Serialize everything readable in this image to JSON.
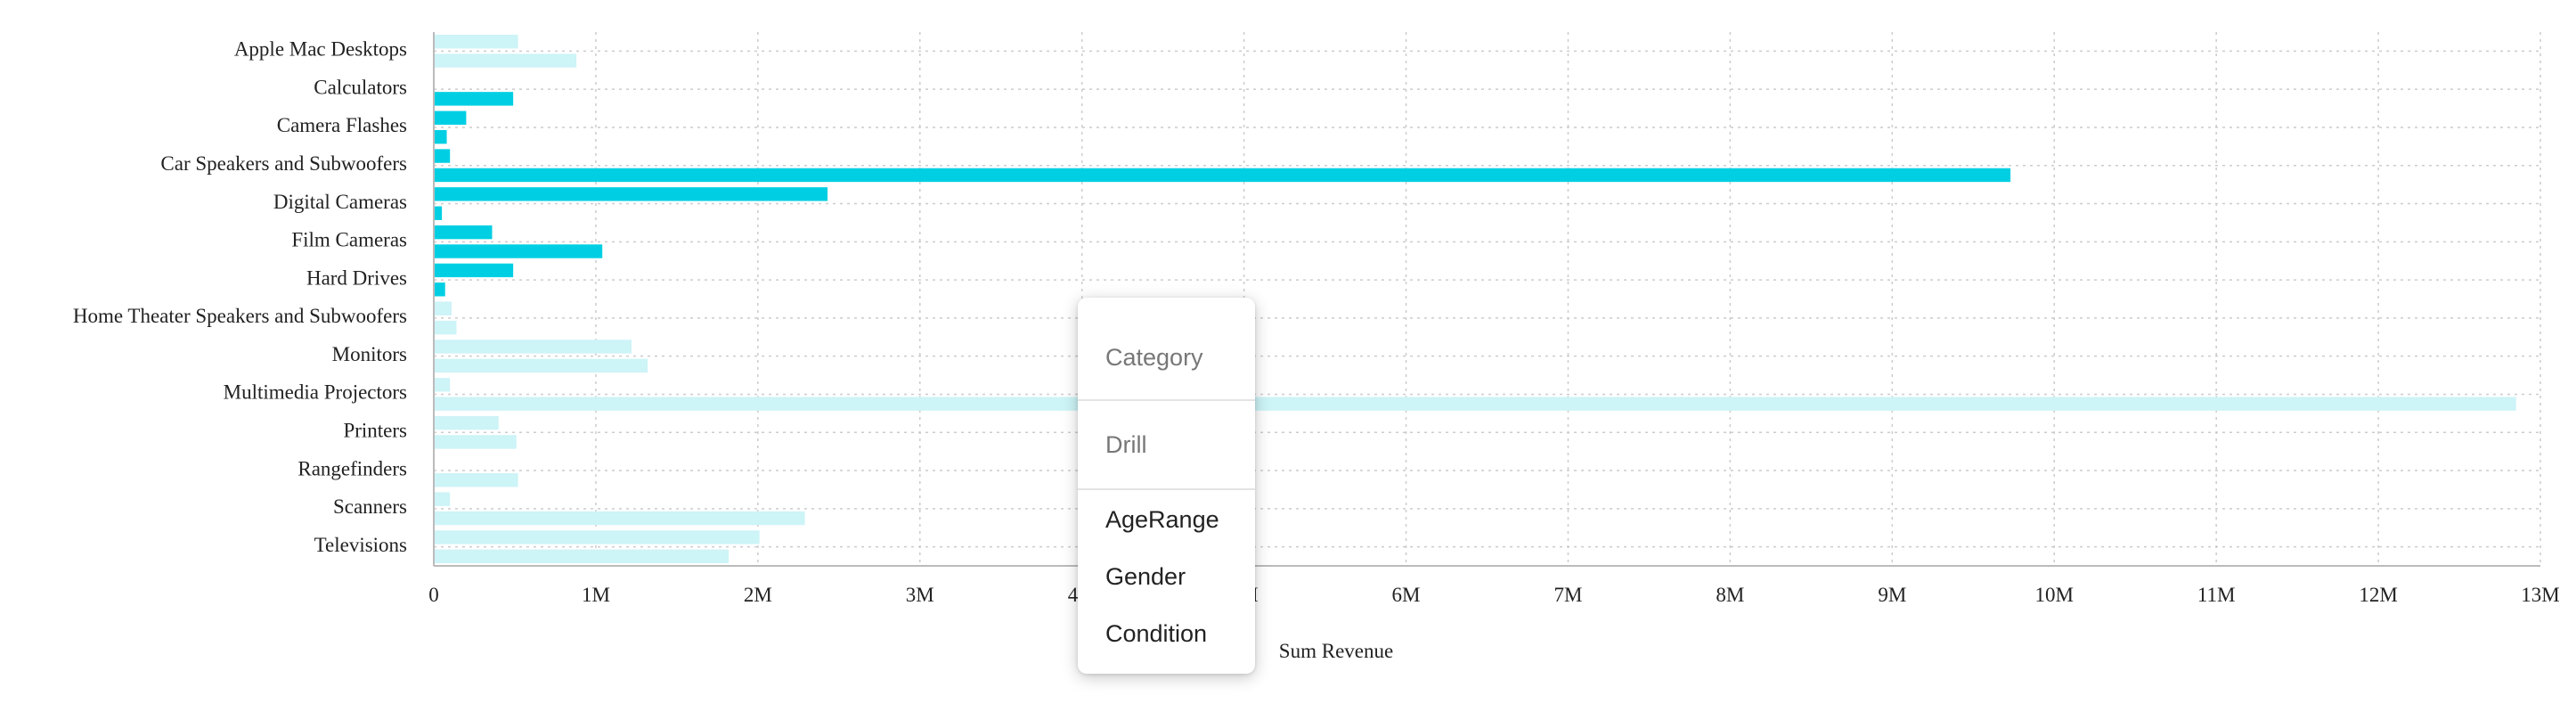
{
  "chart_data": {
    "type": "bar",
    "orientation": "horizontal",
    "title": "",
    "xlabel": "Sum Revenue",
    "ylabel": "",
    "xlim": [
      0,
      13000000
    ],
    "x_ticks": [
      "0",
      "1M",
      "2M",
      "3M",
      "4M",
      "5M",
      "6M",
      "7M",
      "8M",
      "9M",
      "10M",
      "11M",
      "12M",
      "13M"
    ],
    "grid": true,
    "legend": "none",
    "colors": {
      "highlight": "#00cfe3",
      "dim": "#cdf4f7",
      "grid": "#cccccc",
      "axis": "#bbbbbb"
    },
    "categories": [
      "Apple Mac Desktops",
      "Calculators",
      "Camera Flashes",
      "Car Speakers and Subwoofers",
      "Digital Cameras",
      "Film Cameras",
      "Hard Drives",
      "Home Theater Speakers and Subwoofers",
      "Monitors",
      "Multimedia Projectors",
      "Printers",
      "Rangefinders",
      "Scanners",
      "Televisions"
    ],
    "bars": [
      {
        "value": 520000,
        "state": "dim"
      },
      {
        "value": 880000,
        "state": "dim"
      },
      {
        "value": 0,
        "state": "highlight"
      },
      {
        "value": 490000,
        "state": "highlight"
      },
      {
        "value": 200000,
        "state": "highlight"
      },
      {
        "value": 80000,
        "state": "highlight"
      },
      {
        "value": 100000,
        "state": "highlight"
      },
      {
        "value": 9730000,
        "state": "highlight"
      },
      {
        "value": 2430000,
        "state": "highlight"
      },
      {
        "value": 50000,
        "state": "highlight"
      },
      {
        "value": 360000,
        "state": "highlight"
      },
      {
        "value": 1040000,
        "state": "highlight"
      },
      {
        "value": 490000,
        "state": "highlight"
      },
      {
        "value": 70000,
        "state": "highlight"
      },
      {
        "value": 110000,
        "state": "dim"
      },
      {
        "value": 140000,
        "state": "dim"
      },
      {
        "value": 1220000,
        "state": "dim"
      },
      {
        "value": 1320000,
        "state": "dim"
      },
      {
        "value": 100000,
        "state": "dim"
      },
      {
        "value": 12850000,
        "state": "dim"
      },
      {
        "value": 400000,
        "state": "dim"
      },
      {
        "value": 510000,
        "state": "dim"
      },
      {
        "value": 0,
        "state": "dim"
      },
      {
        "value": 520000,
        "state": "dim"
      },
      {
        "value": 100000,
        "state": "dim"
      },
      {
        "value": 2290000,
        "state": "dim"
      },
      {
        "value": 2010000,
        "state": "dim"
      },
      {
        "value": 1820000,
        "state": "dim"
      }
    ]
  },
  "context_menu": {
    "header_category": "Category",
    "header_drill": "Drill",
    "items": [
      "AgeRange",
      "Gender",
      "Condition"
    ]
  }
}
